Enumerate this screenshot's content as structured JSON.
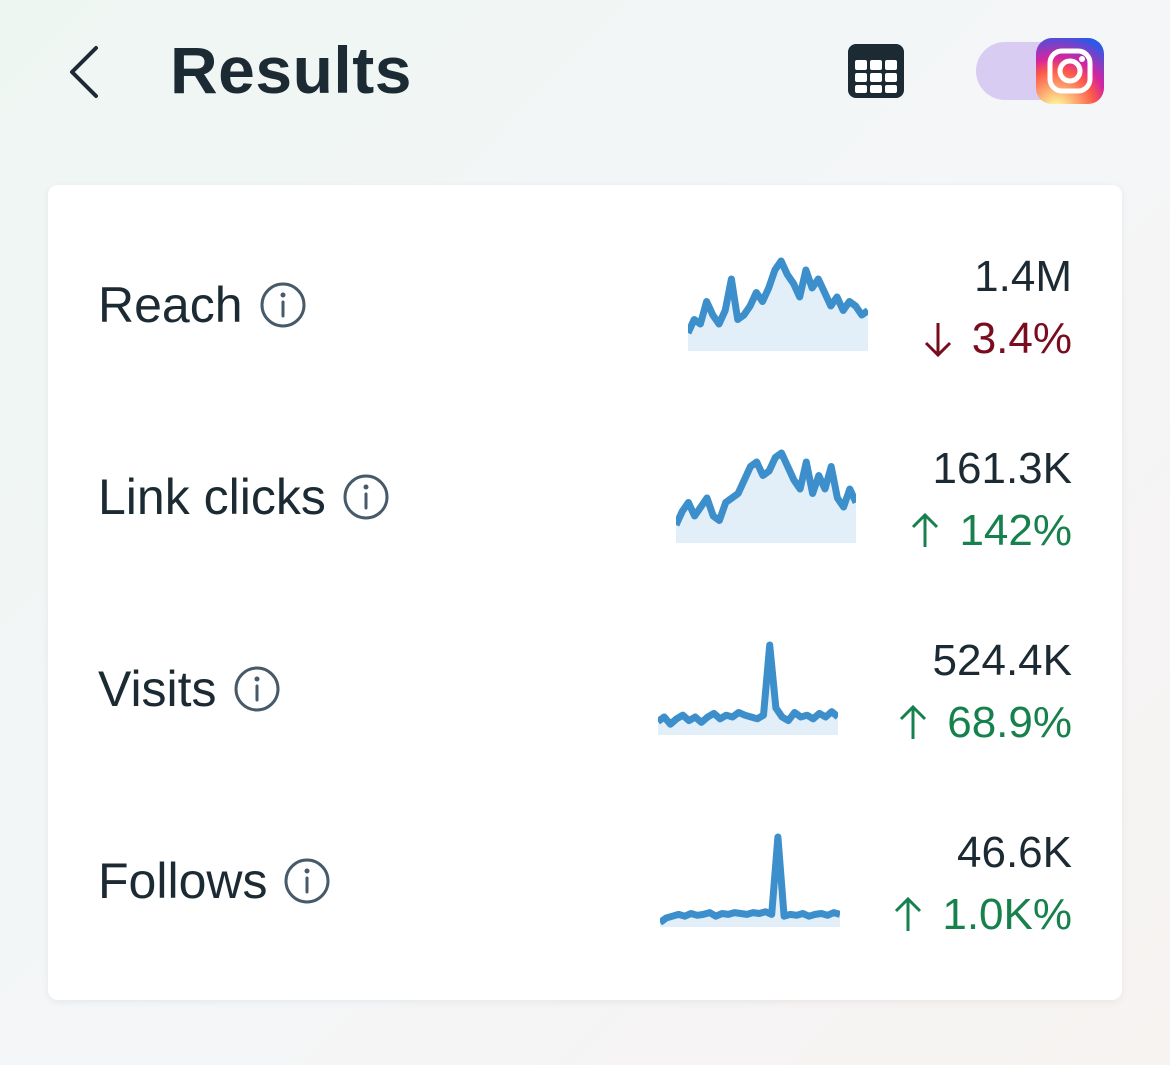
{
  "header": {
    "title": "Results",
    "back_icon": "chevron-left-icon",
    "table_icon": "table-icon",
    "platform_icon": "instagram-icon",
    "toggle_color": "#d8ccf3"
  },
  "metrics": [
    {
      "label": "Reach",
      "value": "1.4M",
      "change": "3.4%",
      "direction": "down",
      "color": "#7a0c1f",
      "spark": [
        0.2,
        0.35,
        0.3,
        0.55,
        0.4,
        0.3,
        0.45,
        0.8,
        0.35,
        0.4,
        0.5,
        0.65,
        0.55,
        0.7,
        0.9,
        1.0,
        0.85,
        0.75,
        0.6,
        0.9,
        0.7,
        0.8,
        0.65,
        0.5,
        0.6,
        0.45,
        0.55,
        0.5,
        0.4,
        0.45
      ]
    },
    {
      "label": "Link clicks",
      "value": "161.3K",
      "change": "142%",
      "direction": "up",
      "color": "#16814c",
      "spark": [
        0.2,
        0.35,
        0.45,
        0.3,
        0.4,
        0.5,
        0.3,
        0.25,
        0.45,
        0.5,
        0.55,
        0.7,
        0.85,
        0.9,
        0.75,
        0.8,
        0.95,
        1.0,
        0.85,
        0.7,
        0.6,
        0.9,
        0.55,
        0.75,
        0.6,
        0.85,
        0.5,
        0.4,
        0.6,
        0.45
      ]
    },
    {
      "label": "Visits",
      "value": "524.4K",
      "change": "68.9%",
      "direction": "up",
      "color": "#16814c",
      "spark": [
        0.15,
        0.2,
        0.12,
        0.18,
        0.22,
        0.16,
        0.2,
        0.14,
        0.2,
        0.24,
        0.18,
        0.22,
        0.2,
        0.25,
        0.22,
        0.2,
        0.18,
        0.22,
        1.0,
        0.3,
        0.2,
        0.16,
        0.25,
        0.2,
        0.22,
        0.18,
        0.24,
        0.2,
        0.26,
        0.2
      ]
    },
    {
      "label": "Follows",
      "value": "46.6K",
      "change": "1.0K%",
      "direction": "up",
      "color": "#16814c",
      "spark": [
        0.05,
        0.1,
        0.12,
        0.14,
        0.12,
        0.15,
        0.13,
        0.14,
        0.16,
        0.12,
        0.15,
        0.14,
        0.16,
        0.15,
        0.14,
        0.16,
        0.15,
        0.17,
        0.14,
        1.0,
        0.12,
        0.14,
        0.13,
        0.15,
        0.12,
        0.14,
        0.15,
        0.13,
        0.16,
        0.14
      ]
    }
  ],
  "spark_color": "#3d8fcc"
}
